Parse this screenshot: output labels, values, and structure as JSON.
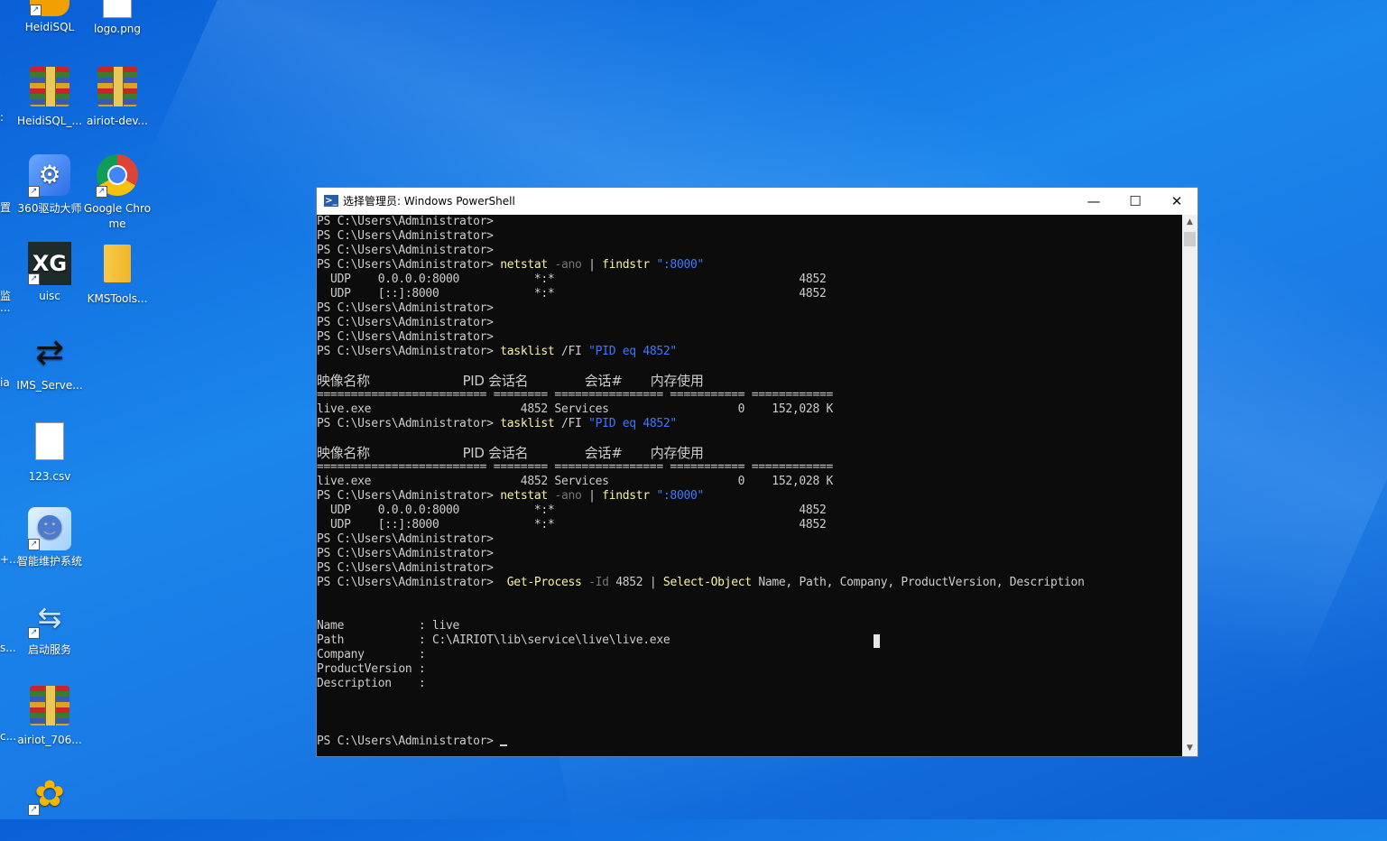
{
  "desktop": {
    "icons": [
      {
        "label": "HeidiSQL",
        "icon": "heidisql-icon"
      },
      {
        "label": "logo.png",
        "icon": "image-file-icon"
      },
      {
        "label": "HeidiSQL_...",
        "icon": "winrar-archive-icon"
      },
      {
        "label": "airiot-dev...",
        "icon": "winrar-archive-icon"
      },
      {
        "label": "360驱动大师",
        "icon": "360-driver-icon"
      },
      {
        "label": "Google Chrome",
        "icon": "chrome-icon"
      },
      {
        "label": "uisc",
        "icon": "xg-icon"
      },
      {
        "label": "KMSTools...",
        "icon": "folder-icon"
      },
      {
        "label": "IMS_Serve...",
        "icon": "ims-server-icon"
      },
      {
        "label": "123.csv",
        "icon": "csv-file-icon"
      },
      {
        "label": "智能维护系统",
        "icon": "maintenance-system-icon"
      },
      {
        "label": "启动服务",
        "icon": "start-service-icon"
      },
      {
        "label": "airiot_706...",
        "icon": "winrar-archive-icon"
      },
      {
        "label": "",
        "icon": "navicat-icon"
      }
    ],
    "edge_labels": [
      ":",
      "置",
      "监",
      "...",
      "ia",
      "+...",
      "s...",
      "c..."
    ]
  },
  "window": {
    "title": "选择管理员: Windows PowerShell",
    "app_icon": "powershell-icon",
    "ps_badge": ">_",
    "controls": {
      "minimize": "—",
      "maximize": "☐",
      "close": "✕"
    },
    "scroll_up": "▲",
    "scroll_down": "▼"
  },
  "console": {
    "prompt": "PS C:\\Users\\Administrator>",
    "cmd_netstat": "netstat",
    "param_ano": "-ano",
    "pipe": "|",
    "cmd_findstr": "findstr",
    "str_port": "\":8000\"",
    "cmd_tasklist": "tasklist",
    "param_fi": "/FI",
    "str_pid": "\"PID eq 4852\"",
    "udp_row1": "  UDP    0.0.0.0:8000           *:*                                    4852",
    "udp_row2": "  UDP    [::]:8000              *:*                                    4852",
    "task_header": "映像名称                       PID 会话名              会话#       内存使用",
    "task_sep": "========================= ======== ================ =========== ============",
    "task_row": "live.exe                      4852 Services                   0    152,028 K",
    "cmd_getprocess": "Get-Process",
    "param_id": "-Id",
    "pid_value": "4852",
    "cmd_select": "Select-Object",
    "select_args": "Name, Path, Company, ProductVersion, Description",
    "result_name": "Name           : live",
    "result_path": "Path           : C:\\AIRIOT\\lib\\service\\live\\live.exe",
    "result_company": "Company        :",
    "result_version": "ProductVersion :",
    "result_description": "Description    :"
  }
}
